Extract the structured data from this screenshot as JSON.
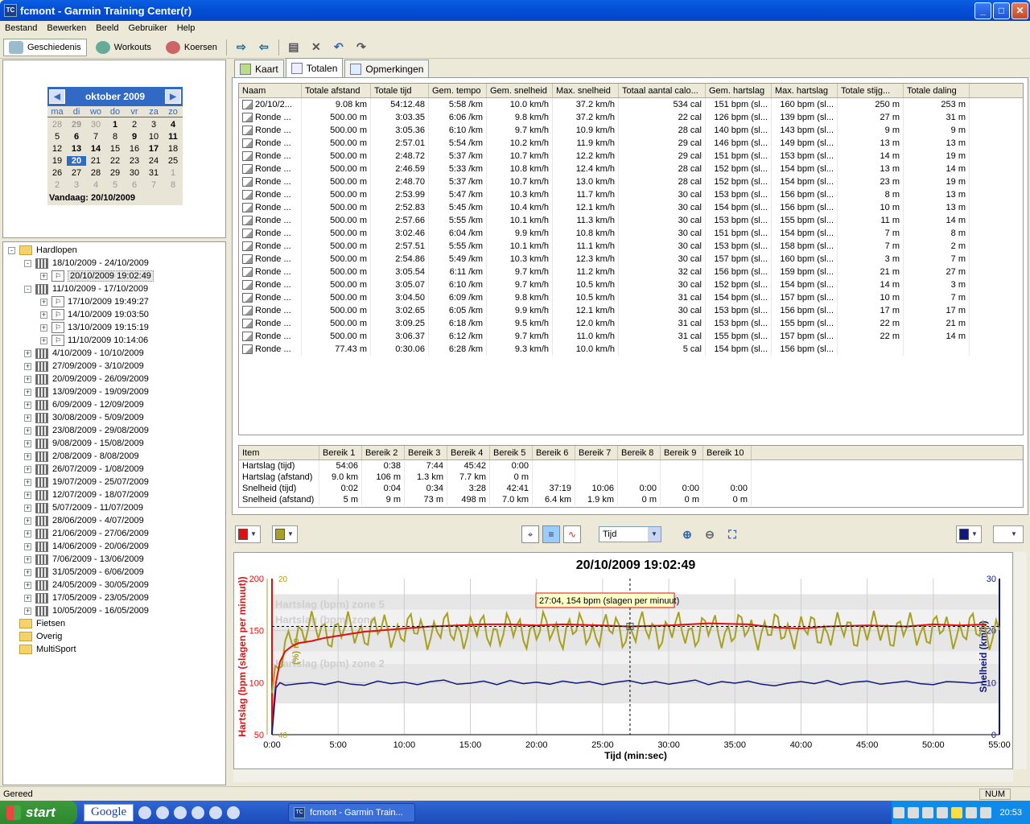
{
  "window": {
    "title": "fcmont - Garmin Training Center(r)"
  },
  "menu": [
    "Bestand",
    "Bewerken",
    "Beeld",
    "Gebruiker",
    "Help"
  ],
  "toolbar": {
    "history": "Geschiedenis",
    "workouts": "Workouts",
    "courses": "Koersen"
  },
  "calendar": {
    "month": "oktober 2009",
    "dow": [
      "ma",
      "di",
      "wo",
      "do",
      "vr",
      "za",
      "zo"
    ],
    "weeks": [
      [
        {
          "d": "28",
          "g": 1
        },
        {
          "d": "29",
          "g": 1,
          "b": 1
        },
        {
          "d": "30",
          "g": 1
        },
        {
          "d": "1",
          "b": 1
        },
        {
          "d": "2"
        },
        {
          "d": "3"
        },
        {
          "d": "4",
          "b": 1
        }
      ],
      [
        {
          "d": "5"
        },
        {
          "d": "6",
          "b": 1
        },
        {
          "d": "7"
        },
        {
          "d": "8"
        },
        {
          "d": "9",
          "b": 1
        },
        {
          "d": "10"
        },
        {
          "d": "11",
          "b": 1
        }
      ],
      [
        {
          "d": "12"
        },
        {
          "d": "13",
          "b": 1
        },
        {
          "d": "14",
          "b": 1
        },
        {
          "d": "15"
        },
        {
          "d": "16"
        },
        {
          "d": "17",
          "b": 1
        },
        {
          "d": "18"
        }
      ],
      [
        {
          "d": "19"
        },
        {
          "d": "20",
          "t": 1
        },
        {
          "d": "21"
        },
        {
          "d": "22"
        },
        {
          "d": "23"
        },
        {
          "d": "24"
        },
        {
          "d": "25"
        }
      ],
      [
        {
          "d": "26"
        },
        {
          "d": "27"
        },
        {
          "d": "28"
        },
        {
          "d": "29"
        },
        {
          "d": "30"
        },
        {
          "d": "31"
        },
        {
          "d": "1",
          "g": 1
        }
      ],
      [
        {
          "d": "2",
          "g": 1
        },
        {
          "d": "3",
          "g": 1
        },
        {
          "d": "4",
          "g": 1
        },
        {
          "d": "5",
          "g": 1
        },
        {
          "d": "6",
          "g": 1
        },
        {
          "d": "7",
          "g": 1
        },
        {
          "d": "8",
          "g": 1
        }
      ]
    ],
    "today": "Vandaag: 20/10/2009"
  },
  "tree": [
    {
      "label": "Hardlopen",
      "level": 0,
      "type": "folder",
      "exp": "-"
    },
    {
      "label": "18/10/2009 - 24/10/2009",
      "level": 1,
      "type": "week",
      "exp": "-"
    },
    {
      "label": "20/10/2009 19:02:49",
      "level": 2,
      "type": "run",
      "exp": "+",
      "sel": true
    },
    {
      "label": "11/10/2009 - 17/10/2009",
      "level": 1,
      "type": "week",
      "exp": "-"
    },
    {
      "label": "17/10/2009 19:49:27",
      "level": 2,
      "type": "run",
      "exp": "+"
    },
    {
      "label": "14/10/2009 19:03:50",
      "level": 2,
      "type": "run",
      "exp": "+"
    },
    {
      "label": "13/10/2009 19:15:19",
      "level": 2,
      "type": "run",
      "exp": "+"
    },
    {
      "label": "11/10/2009 10:14:06",
      "level": 2,
      "type": "run",
      "exp": "+"
    },
    {
      "label": "4/10/2009 - 10/10/2009",
      "level": 1,
      "type": "week",
      "exp": "+"
    },
    {
      "label": "27/09/2009 - 3/10/2009",
      "level": 1,
      "type": "week",
      "exp": "+"
    },
    {
      "label": "20/09/2009 - 26/09/2009",
      "level": 1,
      "type": "week",
      "exp": "+"
    },
    {
      "label": "13/09/2009 - 19/09/2009",
      "level": 1,
      "type": "week",
      "exp": "+"
    },
    {
      "label": "6/09/2009 - 12/09/2009",
      "level": 1,
      "type": "week",
      "exp": "+"
    },
    {
      "label": "30/08/2009 - 5/09/2009",
      "level": 1,
      "type": "week",
      "exp": "+"
    },
    {
      "label": "23/08/2009 - 29/08/2009",
      "level": 1,
      "type": "week",
      "exp": "+"
    },
    {
      "label": "9/08/2009 - 15/08/2009",
      "level": 1,
      "type": "week",
      "exp": "+"
    },
    {
      "label": "2/08/2009 - 8/08/2009",
      "level": 1,
      "type": "week",
      "exp": "+"
    },
    {
      "label": "26/07/2009 - 1/08/2009",
      "level": 1,
      "type": "week",
      "exp": "+"
    },
    {
      "label": "19/07/2009 - 25/07/2009",
      "level": 1,
      "type": "week",
      "exp": "+"
    },
    {
      "label": "12/07/2009 - 18/07/2009",
      "level": 1,
      "type": "week",
      "exp": "+"
    },
    {
      "label": "5/07/2009 - 11/07/2009",
      "level": 1,
      "type": "week",
      "exp": "+"
    },
    {
      "label": "28/06/2009 - 4/07/2009",
      "level": 1,
      "type": "week",
      "exp": "+"
    },
    {
      "label": "21/06/2009 - 27/06/2009",
      "level": 1,
      "type": "week",
      "exp": "+"
    },
    {
      "label": "14/06/2009 - 20/06/2009",
      "level": 1,
      "type": "week",
      "exp": "+"
    },
    {
      "label": "7/06/2009 - 13/06/2009",
      "level": 1,
      "type": "week",
      "exp": "+"
    },
    {
      "label": "31/05/2009 - 6/06/2009",
      "level": 1,
      "type": "week",
      "exp": "+"
    },
    {
      "label": "24/05/2009 - 30/05/2009",
      "level": 1,
      "type": "week",
      "exp": "+"
    },
    {
      "label": "17/05/2009 - 23/05/2009",
      "level": 1,
      "type": "week",
      "exp": "+"
    },
    {
      "label": "10/05/2009 - 16/05/2009",
      "level": 1,
      "type": "week",
      "exp": "+"
    },
    {
      "label": "Fietsen",
      "level": 0,
      "type": "folder",
      "exp": ""
    },
    {
      "label": "Overig",
      "level": 0,
      "type": "folder",
      "exp": ""
    },
    {
      "label": "MultiSport",
      "level": 0,
      "type": "folder",
      "exp": ""
    }
  ],
  "tabs": [
    "Kaart",
    "Totalen",
    "Opmerkingen"
  ],
  "totals": {
    "headers": [
      "Naam",
      "Totale afstand",
      "Totale tijd",
      "Gem. tempo",
      "Gem. snelheid",
      "Max. snelheid",
      "Totaal aantal calo...",
      "Gem. hartslag",
      "Max. hartslag",
      "Totale stijg...",
      "Totale daling"
    ],
    "rows": [
      [
        "20/10/2...",
        "9.08 km",
        "54:12.48",
        "5:58 /km",
        "10.0 km/h",
        "37.2 km/h",
        "534 cal",
        "151 bpm (sl...",
        "160 bpm (sl...",
        "250 m",
        "253 m"
      ],
      [
        "Ronde ...",
        "500.00 m",
        "3:03.35",
        "6:06 /km",
        "9.8 km/h",
        "37.2 km/h",
        "22 cal",
        "126 bpm (sl...",
        "139 bpm (sl...",
        "27 m",
        "31 m"
      ],
      [
        "Ronde ...",
        "500.00 m",
        "3:05.36",
        "6:10 /km",
        "9.7 km/h",
        "10.9 km/h",
        "28 cal",
        "140 bpm (sl...",
        "143 bpm (sl...",
        "9 m",
        "9 m"
      ],
      [
        "Ronde ...",
        "500.00 m",
        "2:57.01",
        "5:54 /km",
        "10.2 km/h",
        "11.9 km/h",
        "29 cal",
        "146 bpm (sl...",
        "149 bpm (sl...",
        "13 m",
        "13 m"
      ],
      [
        "Ronde ...",
        "500.00 m",
        "2:48.72",
        "5:37 /km",
        "10.7 km/h",
        "12.2 km/h",
        "29 cal",
        "151 bpm (sl...",
        "153 bpm (sl...",
        "14 m",
        "19 m"
      ],
      [
        "Ronde ...",
        "500.00 m",
        "2:46.59",
        "5:33 /km",
        "10.8 km/h",
        "12.4 km/h",
        "28 cal",
        "152 bpm (sl...",
        "154 bpm (sl...",
        "13 m",
        "14 m"
      ],
      [
        "Ronde ...",
        "500.00 m",
        "2:48.70",
        "5:37 /km",
        "10.7 km/h",
        "13.0 km/h",
        "28 cal",
        "152 bpm (sl...",
        "154 bpm (sl...",
        "23 m",
        "19 m"
      ],
      [
        "Ronde ...",
        "500.00 m",
        "2:53.99",
        "5:47 /km",
        "10.3 km/h",
        "11.7 km/h",
        "30 cal",
        "153 bpm (sl...",
        "156 bpm (sl...",
        "8 m",
        "13 m"
      ],
      [
        "Ronde ...",
        "500.00 m",
        "2:52.83",
        "5:45 /km",
        "10.4 km/h",
        "12.1 km/h",
        "30 cal",
        "154 bpm (sl...",
        "156 bpm (sl...",
        "10 m",
        "13 m"
      ],
      [
        "Ronde ...",
        "500.00 m",
        "2:57.66",
        "5:55 /km",
        "10.1 km/h",
        "11.3 km/h",
        "30 cal",
        "153 bpm (sl...",
        "155 bpm (sl...",
        "11 m",
        "14 m"
      ],
      [
        "Ronde ...",
        "500.00 m",
        "3:02.46",
        "6:04 /km",
        "9.9 km/h",
        "10.8 km/h",
        "30 cal",
        "151 bpm (sl...",
        "154 bpm (sl...",
        "7 m",
        "8 m"
      ],
      [
        "Ronde ...",
        "500.00 m",
        "2:57.51",
        "5:55 /km",
        "10.1 km/h",
        "11.1 km/h",
        "30 cal",
        "153 bpm (sl...",
        "158 bpm (sl...",
        "7 m",
        "2 m"
      ],
      [
        "Ronde ...",
        "500.00 m",
        "2:54.86",
        "5:49 /km",
        "10.3 km/h",
        "12.3 km/h",
        "30 cal",
        "157 bpm (sl...",
        "160 bpm (sl...",
        "3 m",
        "7 m"
      ],
      [
        "Ronde ...",
        "500.00 m",
        "3:05.54",
        "6:11 /km",
        "9.7 km/h",
        "11.2 km/h",
        "32 cal",
        "156 bpm (sl...",
        "159 bpm (sl...",
        "21 m",
        "27 m"
      ],
      [
        "Ronde ...",
        "500.00 m",
        "3:05.07",
        "6:10 /km",
        "9.7 km/h",
        "10.5 km/h",
        "30 cal",
        "152 bpm (sl...",
        "154 bpm (sl...",
        "14 m",
        "3 m"
      ],
      [
        "Ronde ...",
        "500.00 m",
        "3:04.50",
        "6:09 /km",
        "9.8 km/h",
        "10.5 km/h",
        "31 cal",
        "154 bpm (sl...",
        "157 bpm (sl...",
        "10 m",
        "7 m"
      ],
      [
        "Ronde ...",
        "500.00 m",
        "3:02.65",
        "6:05 /km",
        "9.9 km/h",
        "12.1 km/h",
        "30 cal",
        "153 bpm (sl...",
        "156 bpm (sl...",
        "17 m",
        "17 m"
      ],
      [
        "Ronde ...",
        "500.00 m",
        "3:09.25",
        "6:18 /km",
        "9.5 km/h",
        "12.0 km/h",
        "31 cal",
        "153 bpm (sl...",
        "155 bpm (sl...",
        "22 m",
        "21 m"
      ],
      [
        "Ronde ...",
        "500.00 m",
        "3:06.37",
        "6:12 /km",
        "9.7 km/h",
        "11.0 km/h",
        "31 cal",
        "155 bpm (sl...",
        "157 bpm (sl...",
        "22 m",
        "14 m"
      ],
      [
        "Ronde ...",
        "77.43 m",
        "0:30.06",
        "6:28 /km",
        "9.3 km/h",
        "10.0 km/h",
        "5 cal",
        "154 bpm (sl...",
        "156 bpm (sl...",
        "",
        ""
      ]
    ]
  },
  "ranges": {
    "headers": [
      "Item",
      "Bereik 1",
      "Bereik 2",
      "Bereik 3",
      "Bereik 4",
      "Bereik 5",
      "Bereik 6",
      "Bereik 7",
      "Bereik 8",
      "Bereik 9",
      "Bereik 10"
    ],
    "rows": [
      [
        "Hartslag (tijd)",
        "54:06",
        "0:38",
        "7:44",
        "45:42",
        "0:00",
        "",
        "",
        "",
        "",
        ""
      ],
      [
        "Hartslag (afstand)",
        "9.0 km",
        "106 m",
        "1.3 km",
        "7.7 km",
        "0 m",
        "",
        "",
        "",
        "",
        ""
      ],
      [
        "Snelheid (tijd)",
        "0:02",
        "0:04",
        "0:34",
        "3:28",
        "42:41",
        "37:19",
        "10:06",
        "0:00",
        "0:00",
        "0:00"
      ],
      [
        "Snelheid (afstand)",
        "5 m",
        "9 m",
        "73 m",
        "498 m",
        "7.0 km",
        "6.4 km",
        "1.9 km",
        "0 m",
        "0 m",
        "0 m"
      ]
    ]
  },
  "chart_controls": {
    "xaxis_select": "Tijd",
    "color1": "#e01010",
    "color2": "#a8a020",
    "color3": "#101880"
  },
  "chart_data": {
    "type": "line",
    "title": "20/10/2009 19:02:49",
    "xlabel": "Tijd (min:sec)",
    "ylabel_left": "Hartslag (bpm (slagen per minuut))",
    "ylabel_left2": "(%) ne",
    "ylabel_right": "Snelheid (km/h)",
    "xlim": [
      0,
      55
    ],
    "ylim_left": [
      50,
      200
    ],
    "ylim_left2": [
      40,
      20
    ],
    "ylim_right": [
      0,
      30
    ],
    "x_ticks": [
      "0:00",
      "5:00",
      "10:00",
      "15:00",
      "20:00",
      "25:00",
      "30:00",
      "35:00",
      "40:00",
      "45:00",
      "50:00",
      "55:00"
    ],
    "y_ticks_left": [
      "200",
      "150",
      "100",
      "50"
    ],
    "y_ticks_left2": [
      "20",
      "40"
    ],
    "y_ticks_right": [
      "30",
      "20",
      "10",
      "0"
    ],
    "zones": [
      "Hartslag (bpm) zone 5",
      "Hartslag (bpm) zone",
      "Hartslag (bpm) zone 2"
    ],
    "tooltip": "27:04, 154 bpm (slagen per minuut)",
    "series": [
      {
        "name": "Hartslag",
        "color": "#e01010",
        "x": [
          0,
          0.3,
          0.6,
          1,
          1.5,
          2,
          3,
          4,
          5,
          6,
          7,
          8,
          9,
          10,
          12,
          14,
          16,
          18,
          20,
          22,
          25,
          27,
          30,
          33,
          36,
          38,
          40,
          42,
          45,
          48,
          50,
          52,
          54
        ],
        "values": [
          60,
          100,
          120,
          130,
          135,
          138,
          140,
          143,
          145,
          147,
          149,
          150,
          151,
          152,
          154,
          155,
          156,
          156,
          155,
          156,
          155,
          154,
          155,
          157,
          156,
          153,
          152,
          154,
          155,
          154,
          156,
          155,
          156
        ]
      },
      {
        "name": "Snelheid",
        "color": "#101880",
        "x": [
          0,
          0.3,
          0.6,
          1,
          2,
          3,
          4,
          5,
          6,
          7,
          8,
          9,
          10,
          11,
          12,
          13,
          14,
          15,
          16,
          17,
          18,
          19,
          20,
          21,
          22,
          23,
          24,
          25,
          26,
          27,
          28,
          29,
          30,
          31,
          32,
          33,
          34,
          35,
          36,
          37,
          38,
          39,
          40,
          41,
          42,
          43,
          44,
          45,
          46,
          47,
          48,
          49,
          50,
          51,
          52,
          53,
          54
        ],
        "values": [
          0,
          9,
          10,
          9.5,
          9.8,
          10,
          9.6,
          10.2,
          9.7,
          9.5,
          10.3,
          9.8,
          10.1,
          9.6,
          10.2,
          10.5,
          9.7,
          9.9,
          10.3,
          9.6,
          10.4,
          9.8,
          10.1,
          9.7,
          10.3,
          9.9,
          10.2,
          9.6,
          10.1,
          10.4,
          9.8,
          10.2,
          9.7,
          10.1,
          10.5,
          9.6,
          10.2,
          9.9,
          10.3,
          9.7,
          9.4,
          9.9,
          10.2,
          9.8,
          10.4,
          9.6,
          10.1,
          10.3,
          9.7,
          10,
          10.3,
          9.8,
          9.6,
          10.2,
          10.1,
          9.9,
          10.2
        ]
      }
    ]
  },
  "status": {
    "text": "Gereed",
    "num": "NUM"
  },
  "taskbar": {
    "start": "start",
    "google": "Google",
    "app": "fcmont - Garmin Train...",
    "clock": "20:53"
  }
}
